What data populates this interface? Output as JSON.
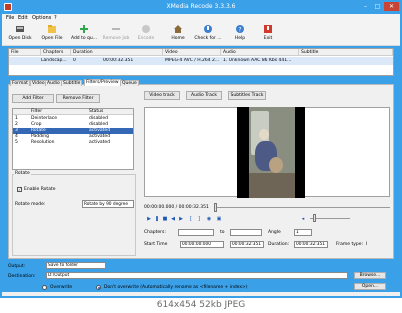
{
  "window": {
    "title": "XMedia Recode 3.3.3.6",
    "min": "–",
    "max": "□",
    "close": "✕"
  },
  "menu": [
    "File",
    "Edit",
    "Options",
    "?"
  ],
  "toolbar": [
    {
      "label": "Open Disk",
      "icon": "disc-icon",
      "enabled": true
    },
    {
      "label": "Open File",
      "icon": "folder-icon",
      "enabled": true
    },
    {
      "label": "Add to qu...",
      "icon": "add-icon",
      "enabled": true
    },
    {
      "label": "Remove Job",
      "icon": "remove-icon",
      "enabled": false
    },
    {
      "label": "Encode",
      "icon": "encode-icon",
      "enabled": false
    },
    {
      "label": "Home",
      "icon": "home-icon",
      "enabled": true
    },
    {
      "label": "Check for ...",
      "icon": "update-icon",
      "enabled": true
    },
    {
      "label": "Help",
      "icon": "help-icon",
      "enabled": true
    },
    {
      "label": "Exit",
      "icon": "exit-icon",
      "enabled": true
    }
  ],
  "file_list": {
    "headers": [
      "File",
      "Chapters",
      "Duration",
      "Video",
      "Audio",
      "Subtitle"
    ],
    "rows": [
      [
        "Landscap...",
        "0",
        "00:00:32.351",
        "MPEG-4 AVC / H.264 2...",
        "1. Unknown AAC 86 Kbs 441...",
        ""
      ]
    ]
  },
  "tabs": [
    "Format",
    "Video",
    "Audio",
    "Subtitle",
    "Filters/Preview",
    "Queue"
  ],
  "active_tab": "Filters/Preview",
  "filter_buttons": {
    "add": "Add Filter",
    "remove": "Remove Filter"
  },
  "filter_table": {
    "headers": [
      "",
      "Filter",
      "Status"
    ],
    "rows": [
      {
        "num": "1",
        "name": "Deinterlace",
        "status": "disabled",
        "selected": false
      },
      {
        "num": "2",
        "name": "Crop",
        "status": "disabled",
        "selected": false
      },
      {
        "num": "3",
        "name": "Rotate",
        "status": "activated",
        "selected": true
      },
      {
        "num": "4",
        "name": "Padding",
        "status": "activated",
        "selected": false
      },
      {
        "num": "5",
        "name": "Resolution",
        "status": "activated",
        "selected": false
      }
    ]
  },
  "rotate": {
    "group_title": "Rotate",
    "enable_label": "Enable Rotate",
    "enabled": true,
    "mode_label": "Rotate mode:",
    "mode_value": "Rotate by 90 degree"
  },
  "preview_buttons": {
    "video": "Video track",
    "audio": "Audio Track",
    "subtitles": "Subtitles Track"
  },
  "player": {
    "time": "00:00:00.000 / 00:00:32.351",
    "position_fraction": 0.0,
    "volume_fraction": 0.1,
    "chapters_label": "Chapters:",
    "to_label": "to",
    "angle_label": "Angle",
    "angle_value": "1",
    "start_label": "Start Time",
    "start_value": "00:00:00:000",
    "end_value": "00:00:32:351",
    "duration_label": "Duration:",
    "duration_value": "00:00:32:351",
    "frame_type_label": "Frame type:",
    "frame_type_value": "I"
  },
  "output": {
    "label": "Output:",
    "value": "Save to folder",
    "dest_label": "Destination:",
    "dest_value": "D:\\Output",
    "browse": "Browse...",
    "open": "Open...",
    "overwrite": "Overwrite",
    "dont_overwrite": "Don't overwrite (Automatically rename as <filename + index>)"
  },
  "caption": "614x454  52kb  JPEG",
  "colors": {
    "title_bar": "#3aa0e8",
    "selection": "#3468b4",
    "close": "#c94434"
  }
}
